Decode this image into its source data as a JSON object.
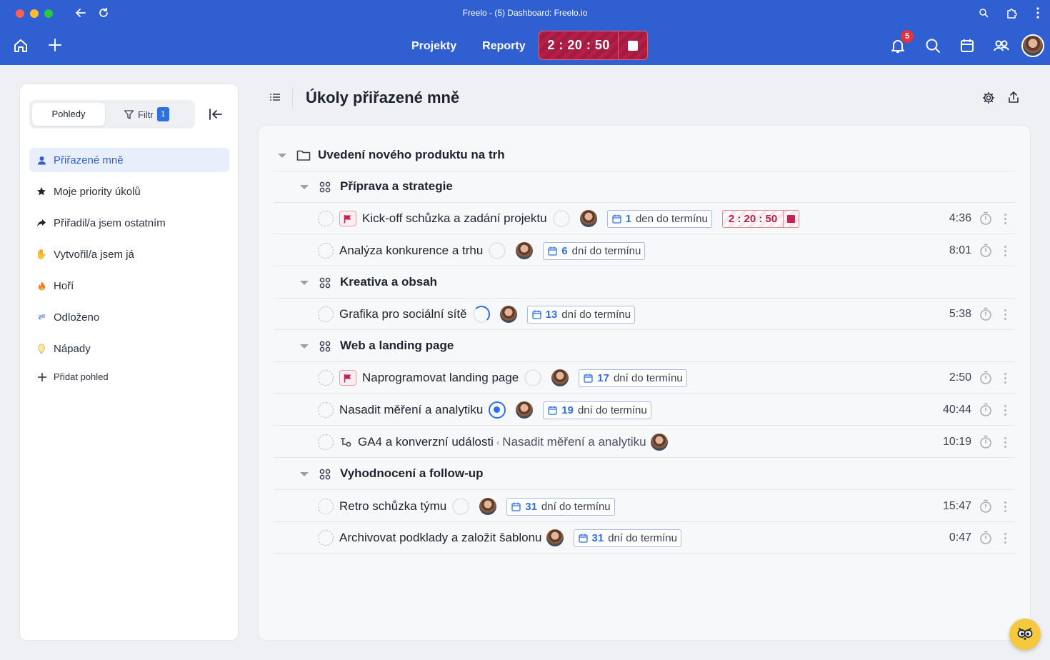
{
  "window": {
    "title": "Freelo - (5) Dashboard: Freelo.io"
  },
  "header": {
    "nav": [
      "Projekty",
      "Reporty"
    ],
    "timer": "2 : 20 : 50",
    "notifications_count": "5"
  },
  "sidebar": {
    "tab_views": "Pohledy",
    "tab_filter": "Filtr",
    "filter_count": "1",
    "items": [
      {
        "label": "Přiřazené mně",
        "icon": "person-icon"
      },
      {
        "label": "Moje priority úkolů",
        "icon": "star-icon"
      },
      {
        "label": "Přiřadil/a jsem ostatním",
        "icon": "share-arrow-icon"
      },
      {
        "label": "Vytvořil/a jsem já",
        "icon": "hand-wave-icon"
      },
      {
        "label": "Hoří",
        "icon": "fire-icon"
      },
      {
        "label": "Odloženo",
        "icon": "zzz-icon"
      },
      {
        "label": "Nápady",
        "icon": "lightbulb-icon"
      }
    ],
    "add_view": "Přidat pohled"
  },
  "main": {
    "title": "Úkoly přiřazené mně",
    "project": "Uvedení nového produktu na trh",
    "groups": [
      {
        "name": "Příprava a strategie"
      },
      {
        "name": "Kreativa a obsah"
      },
      {
        "name": "Web a landing page"
      },
      {
        "name": "Vyhodnocení a follow-up"
      }
    ],
    "tasks": [
      {
        "name": "Kick-off schůzka a zadání projektu",
        "due_num": "1",
        "due_text": "den do termínu",
        "time": "4:36",
        "timer": "2 : 20 : 50"
      },
      {
        "name": "Analýza konkurence a trhu",
        "due_num": "6",
        "due_text": "dní do termínu",
        "time": "8:01"
      },
      {
        "name": "Grafika pro sociální sítě",
        "due_num": "13",
        "due_text": "dní do termínu",
        "time": "5:38"
      },
      {
        "name": "Naprogramovat landing page",
        "due_num": "17",
        "due_text": "dní do termínu",
        "time": "2:50"
      },
      {
        "name": "Nasadit měření a analytiku",
        "due_num": "19",
        "due_text": "dní do termínu",
        "time": "40:44"
      },
      {
        "name": "GA4 a konverzní události",
        "parent_sep": "‹",
        "parent": "Nasadit měření a analytiku",
        "time": "10:19"
      },
      {
        "name": "Retro schůzka týmu",
        "due_num": "31",
        "due_text": "dní do termínu",
        "time": "15:47"
      },
      {
        "name": "Archivovat podklady a založit šablonu",
        "due_num": "31",
        "due_text": "dní do termínu",
        "time": "0:47"
      }
    ]
  },
  "colors": {
    "brand": "#2f5fd1",
    "accent": "#2f6fe4",
    "timer_red": "#b51f47"
  }
}
